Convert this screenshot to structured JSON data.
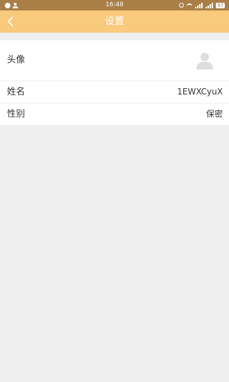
{
  "status_bar": {
    "time": "16:48",
    "battery": "97"
  },
  "header": {
    "title": "设置"
  },
  "settings": {
    "avatar_label": "头像",
    "name_label": "姓名",
    "name_value": "1EWXCyuX",
    "gender_label": "性别",
    "gender_value": "保密"
  },
  "icons": {
    "back": "chevron-left-icon",
    "avatar": "user-icon"
  },
  "colors": {
    "header_bg": "#f9c97c",
    "status_bg": "#a97f47",
    "page_bg": "#efefef",
    "avatar_placeholder": "#dddddd"
  }
}
